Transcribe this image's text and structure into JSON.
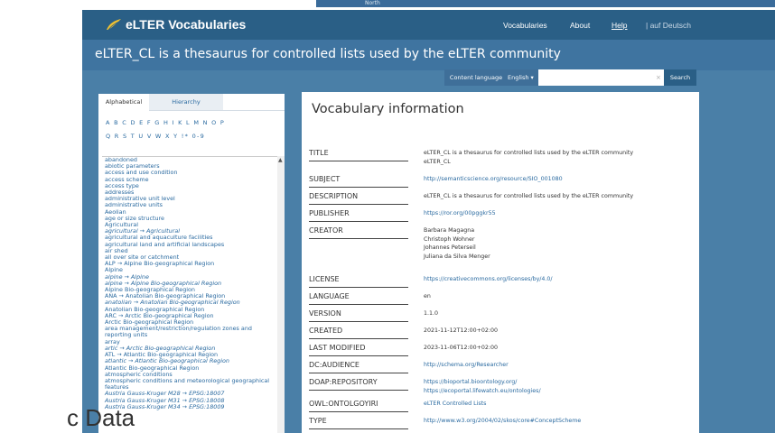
{
  "background": {
    "map_text": "North",
    "data_text": "c Data"
  },
  "header": {
    "logo_text": "eLTER Vocabularies",
    "nav": [
      "Vocabularies",
      "About",
      "Help",
      "| auf Deutsch"
    ]
  },
  "page_heading": "eLTER_CL is a thesaurus for controlled lists used by the eLTER community",
  "search": {
    "content_language_label": "Content language",
    "language_value": "English",
    "placeholder": "",
    "clear": "×",
    "button": "Search"
  },
  "sidebar": {
    "tabs": [
      "Alphabetical",
      "Hierarchy"
    ],
    "letters_row1": "A B C D E F G H I K L M N O P",
    "letters_row2": "Q R S T U V W X Y !* 0-9",
    "concepts": [
      "abandoned",
      "abiotic parameters",
      "access and use condition",
      "access scheme",
      "access type",
      "addresses",
      "administrative unit level",
      "administrative units",
      "Aeolian",
      "age or size structure",
      "Agricultural",
      "agricultural → Agricultural",
      "agricultural and aquaculture facilities",
      "agricultural land and artificial landscapes",
      "air shed",
      "all over site or catchment",
      "ALP → Alpine Bio-geographical Region",
      "Alpine",
      "alpine → Alpine",
      "alpine → Alpine Bio-geographical Region",
      "Alpine Bio-geographical Region",
      "ANA → Anatolian Bio-geographical Region",
      "anatolian → Anatolian Bio-geographical Region",
      "Anatolian Bio-geographical Region",
      "ARC → Arctic Bio-geographical Region",
      "Arctic Bio-geographical Region",
      "area management/restriction/regulation zones and reporting units",
      "array",
      "artic → Arctic Bio-geographical Region",
      "ATL → Atlantic Bio-geographical Region",
      "atlantic → Atlantic Bio-geographical Region",
      "Atlantic Bio-geographical Region",
      "atmospheric conditions",
      "atmospheric conditions and meteorological geographical features",
      "Austria Gauss-Kruger M28 → EPSG:18007",
      "Austria Gauss-Kruger M31 → EPSG:18008",
      "Austria Gauss-Kruger M34 → EPSG:18009"
    ]
  },
  "vocabulary": {
    "title": "Vocabulary information",
    "rows": [
      {
        "label": "TITLE",
        "values": [
          "eLTER_CL is a thesaurus for controlled lists used by the eLTER community",
          "eLTER_CL"
        ]
      },
      {
        "label": "SUBJECT",
        "values": [
          "http://semanticscience.org/resource/SIO_001080"
        ]
      },
      {
        "label": "DESCRIPTION",
        "values": [
          "eLTER_CL is a thesaurus for controlled lists used by the eLTER community"
        ]
      },
      {
        "label": "PUBLISHER",
        "values": [
          "https://ror.org/00pggkr55"
        ]
      },
      {
        "label": "CREATOR",
        "values": [
          "Barbara Magagna",
          "Christoph Wohner",
          "Johannes Peterseil",
          "Juliana da Silva Menger"
        ]
      },
      {
        "label": "LICENSE",
        "values": [
          "https://creativecommons.org/licenses/by/4.0/"
        ]
      },
      {
        "label": "LANGUAGE",
        "values": [
          "en"
        ]
      },
      {
        "label": "VERSION",
        "values": [
          "1.1.0"
        ]
      },
      {
        "label": "CREATED",
        "values": [
          "2021-11-12T12:00+02:00"
        ]
      },
      {
        "label": "LAST MODIFIED",
        "values": [
          "2023-11-06T12:00+02:00"
        ]
      },
      {
        "label": "DC:AUDIENCE",
        "values": [
          "http://schema.org/Researcher"
        ]
      },
      {
        "label": "DOAP:REPOSITORY",
        "values": [
          "https://bioportal.bioontology.org/",
          "https://ecoportal.lifewatch.eu/ontologies/"
        ]
      },
      {
        "label": "OWL:ONTOLGOYIRI",
        "values": [
          "eLTER Controlled Lists"
        ]
      },
      {
        "label": "TYPE",
        "values": [
          "http://www.w3.org/2004/02/skos/core#ConceptScheme"
        ]
      }
    ]
  }
}
